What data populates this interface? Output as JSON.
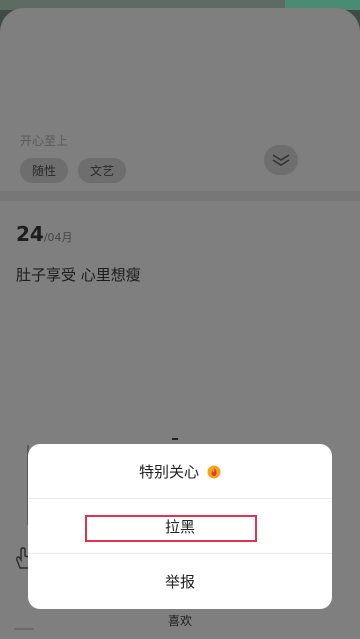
{
  "background": {
    "mood_text": "开心至上",
    "tags": [
      "随性",
      "文艺"
    ],
    "entry": {
      "day": "24",
      "month": "/04月",
      "text": "肚子享受 心里想瘦"
    },
    "like_label": "喜欢"
  },
  "menu": {
    "items": [
      {
        "label": "特别关心",
        "icon": "flame-badge-icon"
      },
      {
        "label": "拉黑",
        "highlighted": true
      },
      {
        "label": "举报"
      }
    ]
  },
  "colors": {
    "overlay_sheet": "#7f7f7f",
    "menu_bg": "#ffffff",
    "highlight": "#e0334f",
    "accent_green": "#4a8b73"
  }
}
